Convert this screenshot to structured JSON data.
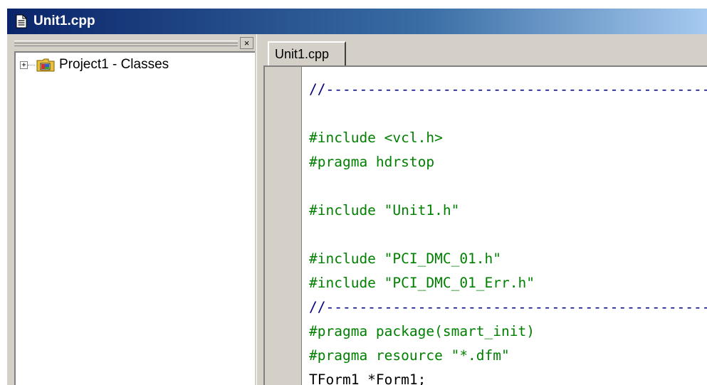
{
  "window": {
    "title": "Unit1.cpp",
    "title_icon": "document-icon"
  },
  "class_explorer": {
    "close_label": "×",
    "tree": [
      {
        "label": "Project1 - Classes",
        "icon": "folder-classes-icon",
        "expander": "+"
      }
    ]
  },
  "editor": {
    "tab_label": "Unit1.cpp",
    "lines": [
      {
        "text": "//---------------------------------------------------",
        "kind": "comment"
      },
      {
        "text": "",
        "kind": "plain"
      },
      {
        "text": "#include <vcl.h>",
        "kind": "pp"
      },
      {
        "text": "#pragma hdrstop",
        "kind": "pp"
      },
      {
        "text": "",
        "kind": "plain"
      },
      {
        "text": "#include \"Unit1.h\"",
        "kind": "pp"
      },
      {
        "text": "",
        "kind": "plain"
      },
      {
        "text": "#include \"PCI_DMC_01.h\"",
        "kind": "pp"
      },
      {
        "text": "#include \"PCI_DMC_01_Err.h\"",
        "kind": "pp"
      },
      {
        "text": "//---------------------------------------------------",
        "kind": "comment"
      },
      {
        "text": "#pragma package(smart_init)",
        "kind": "pp"
      },
      {
        "text": "#pragma resource \"*.dfm\"",
        "kind": "pp"
      },
      {
        "text": "TForm1 *Form1;",
        "kind": "plain"
      }
    ]
  },
  "colors": {
    "titlebar_start": "#0a246a",
    "titlebar_end": "#a6caf0",
    "comment": "#000080",
    "preprocessor": "#008000",
    "plain": "#000000",
    "chrome": "#d4d0c8"
  }
}
